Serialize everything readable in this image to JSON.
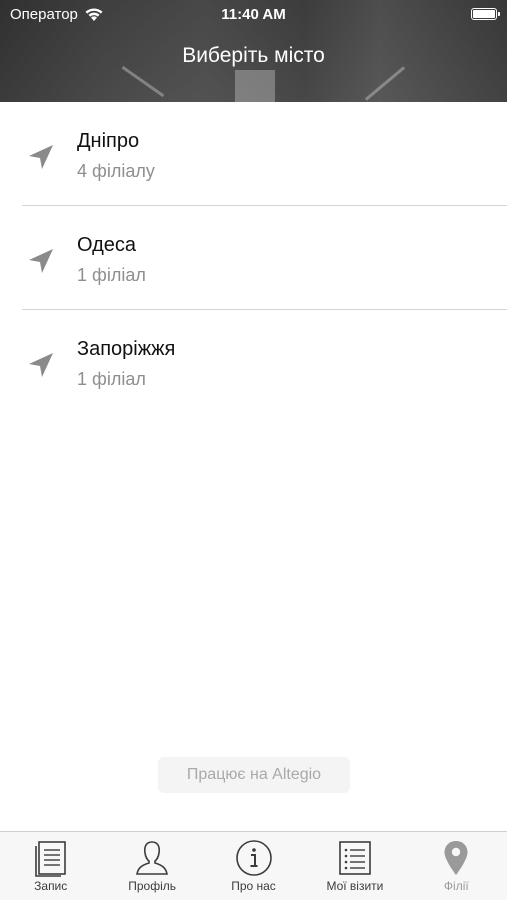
{
  "status_bar": {
    "carrier": "Оператор",
    "time": "11:40 AM"
  },
  "header": {
    "title": "Виберіть місто"
  },
  "cities": [
    {
      "name": "Дніпро",
      "count": "4 філіалу"
    },
    {
      "name": "Одеса",
      "count": "1 філіал"
    },
    {
      "name": "Запоріжжя",
      "count": "1 філіал"
    }
  ],
  "footer": {
    "powered_by": "Працює на Altegio"
  },
  "tabs": [
    {
      "label": "Запис",
      "icon": "document-icon"
    },
    {
      "label": "Профіль",
      "icon": "person-icon"
    },
    {
      "label": "Про нас",
      "icon": "info-icon"
    },
    {
      "label": "Мої візити",
      "icon": "list-icon"
    },
    {
      "label": "Філії",
      "icon": "map-pin-icon",
      "active": true
    }
  ],
  "colors": {
    "text_primary": "#111111",
    "text_secondary": "#8e8e93",
    "tab_active": "#9a9a9a",
    "tab_inactive": "#3c3c3c"
  }
}
